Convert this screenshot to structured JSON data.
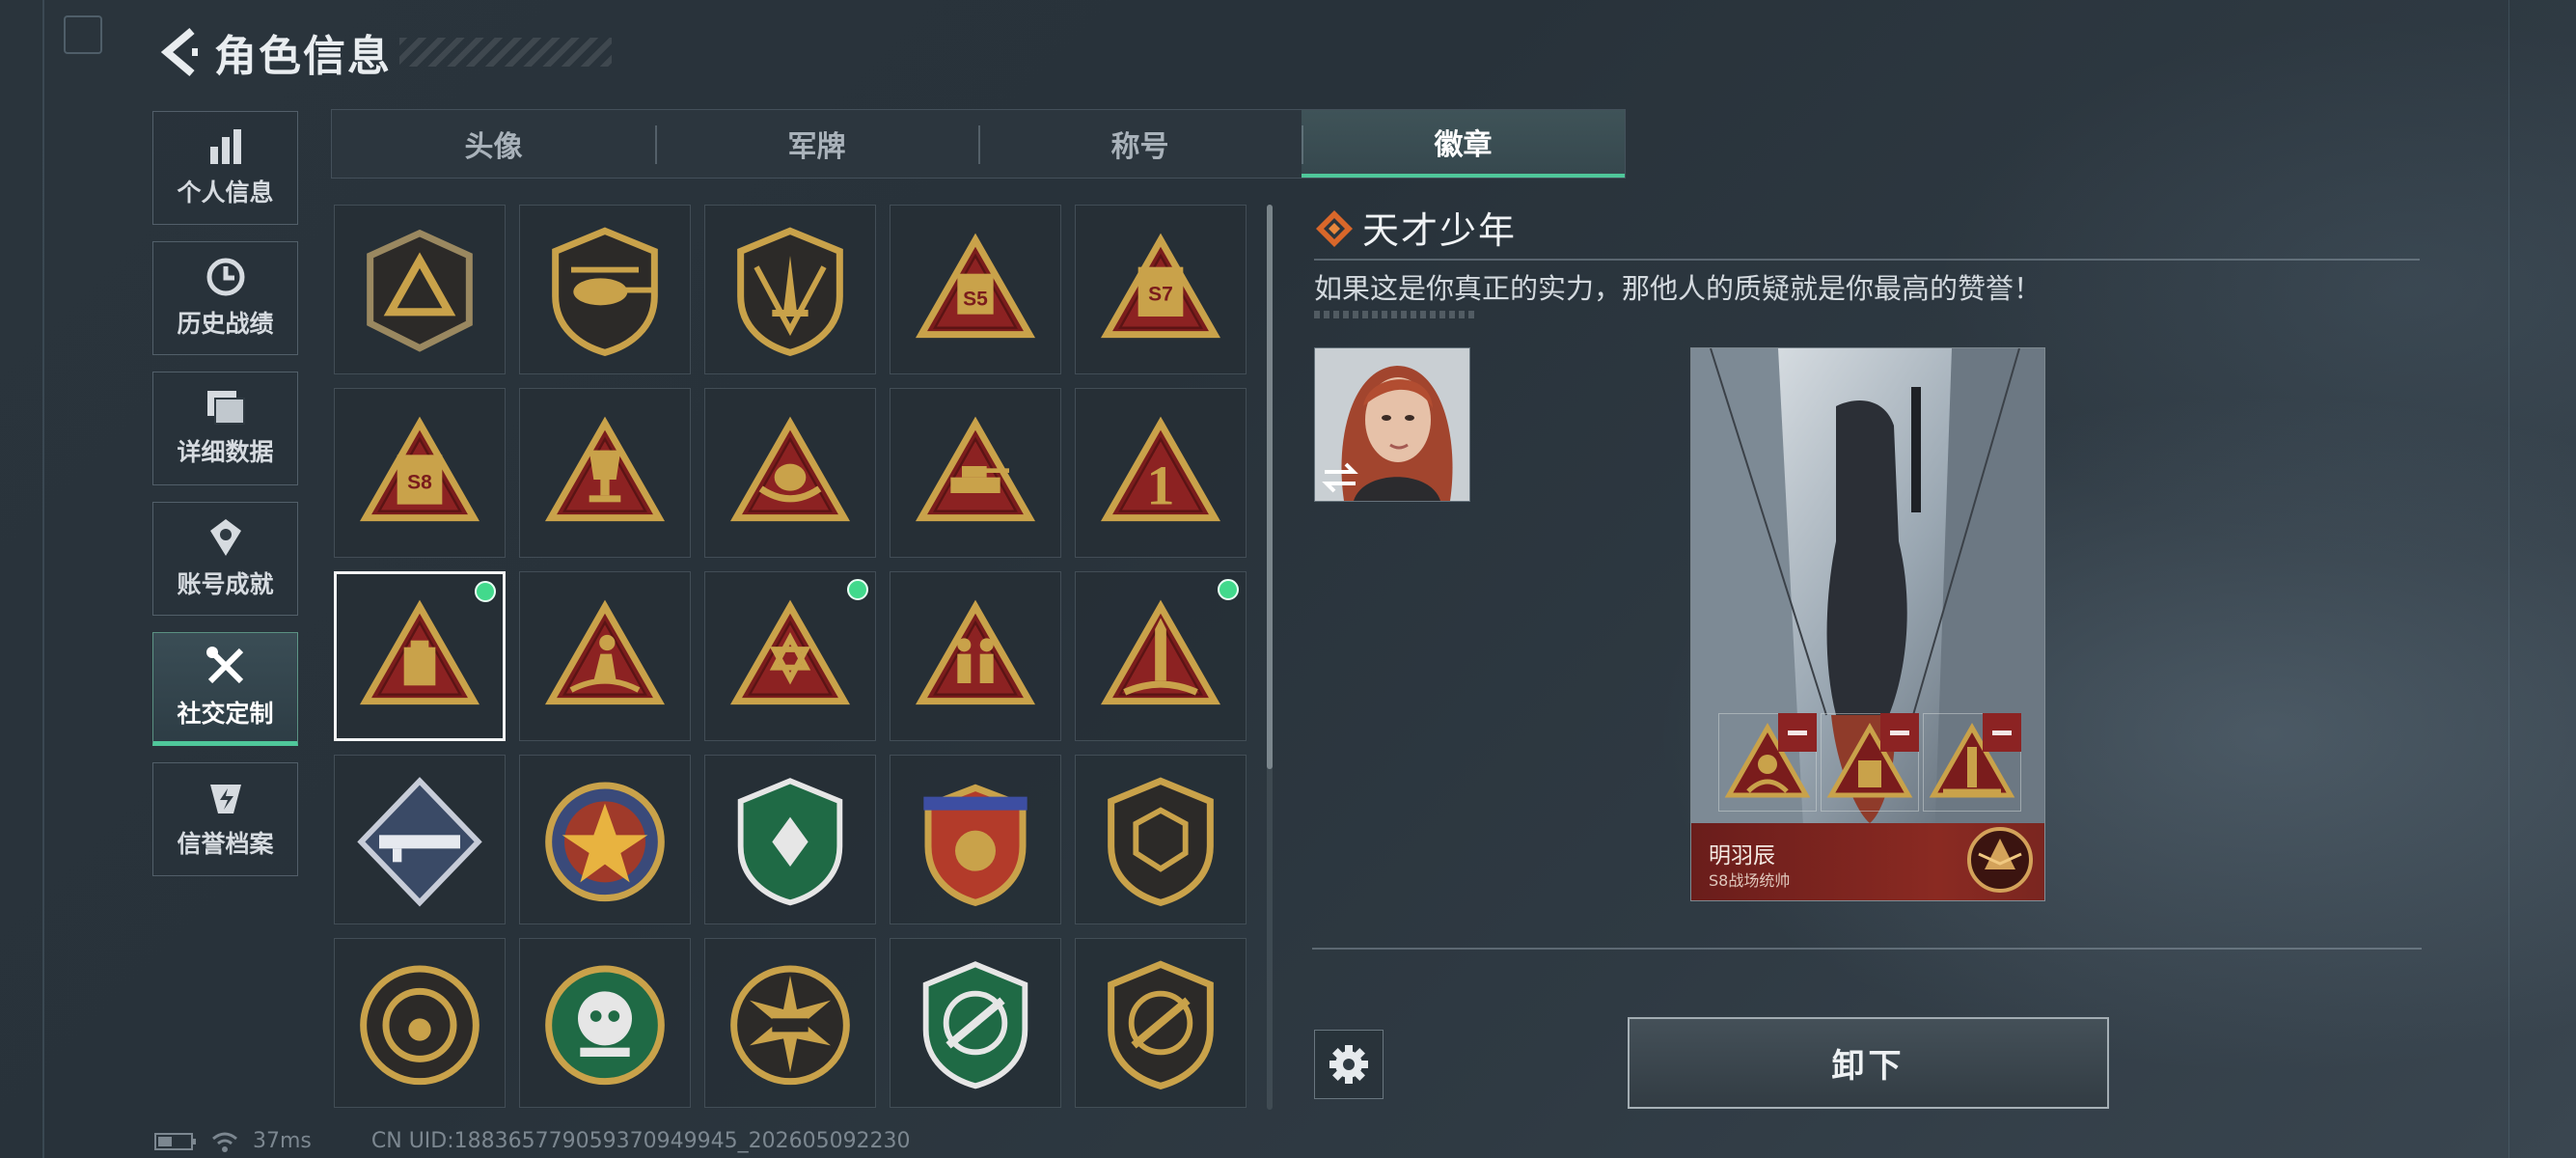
{
  "header": {
    "title": "角色信息"
  },
  "nav": {
    "items": [
      {
        "label": "个人信息",
        "icon": "bar-chart-icon"
      },
      {
        "label": "历史战绩",
        "icon": "history-clock-icon"
      },
      {
        "label": "详细数据",
        "icon": "folder-icon"
      },
      {
        "label": "账号成就",
        "icon": "achievement-icon"
      },
      {
        "label": "社交定制",
        "icon": "tools-icon",
        "active": true
      },
      {
        "label": "信誉档案",
        "icon": "credit-badge-icon"
      }
    ]
  },
  "tabs": [
    {
      "label": "头像"
    },
    {
      "label": "军牌"
    },
    {
      "label": "称号"
    },
    {
      "label": "徽章",
      "active": true
    }
  ],
  "badges": {
    "selected_index": 10,
    "equipped_indices": [
      10,
      12,
      14
    ],
    "items": [
      "shield-triangle-badge",
      "helicopter-badge",
      "dagger-shield-badge",
      "s5-triangle-badge",
      "s7-triangle-badge",
      "s8-triangle-badge",
      "trophy-triangle-badge",
      "egg-nest-triangle-badge",
      "tank-triangle-badge",
      "number-one-triangle-badge",
      "box-triangle-badge",
      "runner-triangle-badge",
      "star-of-david-triangle-badge",
      "soldiers-triangle-badge",
      "rocket-triangle-badge",
      "rocket-launcher-diamond-badge",
      "star-circle-badge",
      "green-wing-shield-badge",
      "eu-stars-shield-badge",
      "hexagon-shield-badge",
      "pearl-circle-badge",
      "skull-cross-badge",
      "tank-sun-badge",
      "rifle-green-shield-badge",
      "rifle-gold-shield-badge"
    ]
  },
  "detail": {
    "title": "天才少年",
    "description": "如果这是你真正的实力，那他人的质疑就是你最高的赞誉！",
    "card": {
      "player_name": "明羽辰",
      "rank": "S8战场统帅"
    },
    "unequip_label": "卸下"
  },
  "status": {
    "latency": "37ms",
    "uid": "CN UID:188365779059370949945_202605092230"
  },
  "colors": {
    "accent": "#4fc79a",
    "equipped_dot": "#42d98c",
    "gold": "#c9a24a",
    "triangle_red": "#7a1c1c"
  }
}
